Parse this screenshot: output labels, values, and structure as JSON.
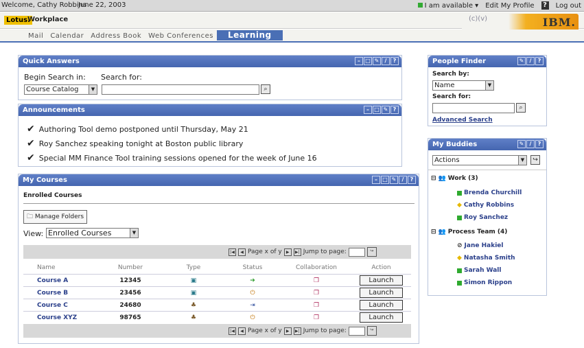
{
  "topbar": {
    "welcome": "Welcome, Cathy Robbins",
    "date": "June 22, 2003",
    "availability": "I am available",
    "edit_profile": "Edit My Profile",
    "help": "?",
    "logout": "Log out"
  },
  "brand": {
    "lotus": "Lotus.",
    "product": "Workplace",
    "ibm": "IBM.",
    "glyphs": "(c)(v)"
  },
  "nav": [
    {
      "label": "Mail"
    },
    {
      "label": "Calendar"
    },
    {
      "label": "Address Book"
    },
    {
      "label": "Web Conferences"
    },
    {
      "label": "Learning",
      "active": true
    }
  ],
  "quick_answers": {
    "title": "Quick Answers",
    "begin_label": "Begin Search in:",
    "search_label": "Search for:",
    "scope_value": "Course Catalog",
    "query_value": ""
  },
  "announcements": {
    "title": "Announcements",
    "items": [
      "Authoring Tool demo postponed until Thursday, May 21",
      "Roy Sanchez speaking tonight at Boston public library",
      "Special MM Finance Tool training sessions opened for the week of June 16"
    ]
  },
  "my_courses": {
    "title": "My Courses",
    "section": "Enrolled Courses",
    "manage_folders": "Manage Folders",
    "view_label": "View:",
    "view_value": "Enrolled Courses",
    "pager": {
      "page_text": "Page x of y",
      "jump_label": "Jump to page:"
    },
    "columns": [
      "Name",
      "Number",
      "Type",
      "Status",
      "Collaboration",
      "Action"
    ],
    "rows": [
      {
        "name": "Course A",
        "number": "12345",
        "action": "Launch"
      },
      {
        "name": "Course B",
        "number": "23456",
        "action": "Launch"
      },
      {
        "name": "Course C",
        "number": "24680",
        "action": "Launch"
      },
      {
        "name": "Course XYZ",
        "number": "98765",
        "action": "Launch"
      }
    ]
  },
  "people_finder": {
    "title": "People Finder",
    "search_by_label": "Search by:",
    "search_by_value": "Name",
    "search_for_label": "Search for:",
    "advanced_link": "Advanced Search"
  },
  "buddies": {
    "title": "My Buddies",
    "actions_value": "Actions",
    "groups": [
      {
        "name": "Work (3)",
        "members": [
          {
            "name": "Brenda Churchill",
            "status_color": "#2faa2f",
            "icon": "green-square"
          },
          {
            "name": "Cathy Robbins",
            "status_color": "#e6b800",
            "icon": "yellow-diamond"
          },
          {
            "name": "Roy Sanchez",
            "status_color": "#2faa2f",
            "icon": "green-square"
          }
        ]
      },
      {
        "name": "Process Team (4)",
        "members": [
          {
            "name": "Jane Hakiel",
            "status_color": "#333333",
            "icon": "do-not-disturb"
          },
          {
            "name": "Natasha Smith",
            "status_color": "#e6b800",
            "icon": "yellow-diamond"
          },
          {
            "name": "Sarah Wall",
            "status_color": "#2faa2f",
            "icon": "green-square"
          },
          {
            "name": "Simon Rippon",
            "status_color": "#2faa2f",
            "icon": "green-square"
          }
        ]
      }
    ]
  },
  "colors": {
    "portlet_title": "#4a6fb5",
    "nav_active": "#4a6fb5",
    "link": "#2a3f8a"
  }
}
